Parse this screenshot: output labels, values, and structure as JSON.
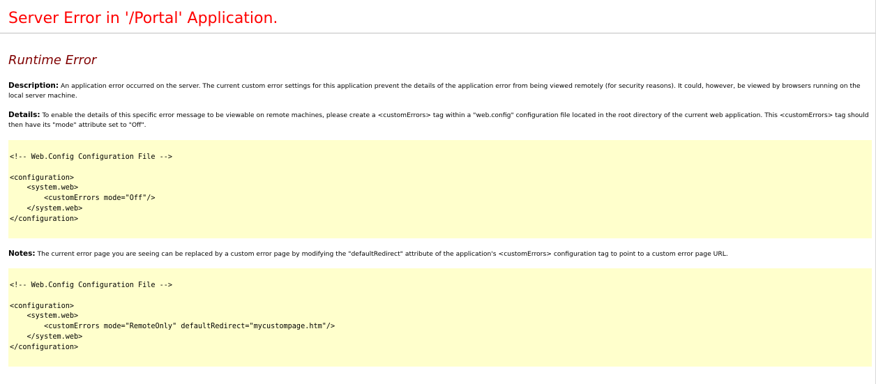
{
  "page": {
    "title": "Server Error in '/Portal' Application.",
    "subtitle": "Runtime Error",
    "description": {
      "label": "Description:",
      "text": "An application error occurred on the server. The current custom error settings for this application prevent the details of the application error from being viewed remotely (for security reasons). It could, however, be viewed by browsers running on the local server machine."
    },
    "details": {
      "label": "Details:",
      "text": "To enable the details of this specific error message to be viewable on remote machines, please create a <customErrors> tag within a \"web.config\" configuration file located in the root directory of the current web application. This <customErrors> tag should then have its \"mode\" attribute set to \"Off\"."
    },
    "code_sample_1": "<!-- Web.Config Configuration File -->\n\n<configuration>\n    <system.web>\n        <customErrors mode=\"Off\"/>\n    </system.web>\n</configuration>",
    "notes": {
      "label": "Notes:",
      "text": "The current error page you are seeing can be replaced by a custom error page by modifying the \"defaultRedirect\" attribute of the application's <customErrors> configuration tag to point to a custom error page URL."
    },
    "code_sample_2": "<!-- Web.Config Configuration File -->\n\n<configuration>\n    <system.web>\n        <customErrors mode=\"RemoteOnly\" defaultRedirect=\"mycustompage.htm\"/>\n    </system.web>\n</configuration>"
  },
  "colors": {
    "title": "#ff0000",
    "subtitle": "#800000",
    "code_background": "#ffffcc",
    "rule": "#c0c0c0"
  }
}
